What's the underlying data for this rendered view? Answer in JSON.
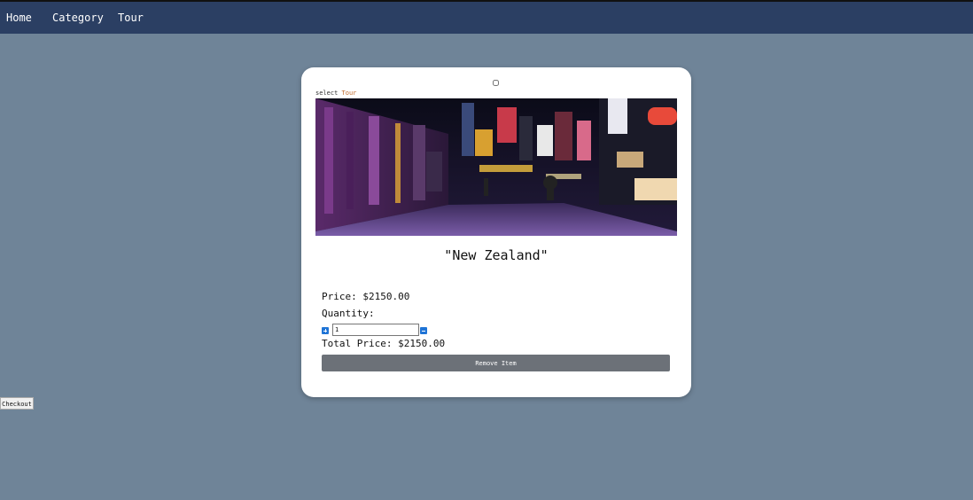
{
  "nav": {
    "home": "Home",
    "category": "Category",
    "tour": "Tour"
  },
  "card": {
    "select_prefix": "select ",
    "select_accent": "Tour",
    "tour_name": "\"New Zealand\"",
    "price": "Price: $2150.00",
    "quantity_label": "Quantity:",
    "quantity_value": "1",
    "total_price": "Total Price: $2150.00",
    "remove_label": "Remove Item",
    "image_alt": "city street at night"
  },
  "checkout_label": "Checkout",
  "colors": {
    "background": "#6f8498",
    "navbar": "#2b3f63",
    "remove_button": "#6c7178",
    "qty_buttons": "#1f74d6"
  },
  "icons": {
    "plus": "plus-square-icon",
    "minus": "minus-square-icon"
  }
}
